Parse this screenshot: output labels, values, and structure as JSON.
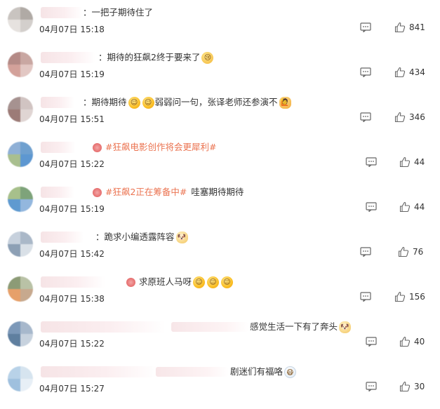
{
  "comments": [
    {
      "prefix": "：",
      "hashtag": "",
      "text": "一把子期待住了",
      "emoji": [],
      "timestamp": "04月07日 15:18",
      "likes": "841",
      "avatar_colors": [
        "#c9c4c0",
        "#b0aaa5",
        "#e6e2df",
        "#d3cfcc"
      ]
    },
    {
      "prefix": "：",
      "hashtag": "",
      "text": "期待的狂飙2终于要来了",
      "emoji": [
        "cry"
      ],
      "timestamp": "04月07日 15:19",
      "likes": "434",
      "avatar_colors": [
        "#b48a86",
        "#c9a7a2",
        "#d3a19a",
        "#e2c7c3"
      ]
    },
    {
      "prefix": "：",
      "hashtag": "",
      "text": "期待期待",
      "text2": "弱弱问一句，张译老师还参演不",
      "emoji": [
        "smile",
        "smile"
      ],
      "emoji_end": "wave",
      "timestamp": "04月07日 15:51",
      "likes": "346",
      "avatar_colors": [
        "#a69290",
        "#d1c4c2",
        "#9c7b77",
        "#e0d5d3"
      ]
    },
    {
      "prefix": "",
      "hashtag": "#狂飙电影创作将会更犀利#",
      "text": "",
      "emoji": [
        "heart"
      ],
      "timestamp": "04月07日 15:22",
      "likes": "44",
      "avatar_colors": [
        "#8fb0d6",
        "#6fa0cf",
        "#a9bf8f",
        "#5d97d1"
      ]
    },
    {
      "prefix": "",
      "hashtag": "#狂飙2正在筹备中#",
      "text": "哇塞期待期待",
      "emoji": [
        "heart"
      ],
      "timestamp": "04月07日 15:19",
      "likes": "44",
      "avatar_colors": [
        "#a7c08b",
        "#7ea37a",
        "#5f9ad0",
        "#93b7de"
      ]
    },
    {
      "prefix": "：",
      "hashtag": "",
      "text": "跪求小编透露阵容",
      "emoji": [
        "dog"
      ],
      "timestamp": "04月07日 15:42",
      "likes": "76",
      "avatar_colors": [
        "#c7d1dd",
        "#aab8c8",
        "#8da0b5",
        "#d9e0e7"
      ]
    },
    {
      "prefix": "",
      "hashtag": "",
      "text": "求原班人马呀",
      "emoji": [
        "heart"
      ],
      "emoji_end3": "smile",
      "timestamp": "04月07日 15:38",
      "likes": "156",
      "avatar_colors": [
        "#8c9b76",
        "#b9c2a6",
        "#e6a06a",
        "#c7a98e"
      ]
    },
    {
      "prefix": "",
      "hashtag": "",
      "text": "感觉生活一下有了奔头",
      "emoji": [],
      "emoji_end": "dog",
      "timestamp": "04月07日 15:22",
      "likes": "40",
      "avatar_colors": [
        "#7c98b8",
        "#a7b8cc",
        "#5f7f9f",
        "#c7d2de"
      ]
    },
    {
      "prefix": "",
      "hashtag": "",
      "text": "剧迷们有福咯",
      "emoji": [],
      "emoji_end": "sick",
      "timestamp": "04月07日 15:27",
      "likes": "30",
      "avatar_colors": [
        "#b8d2e8",
        "#d6e4ef",
        "#9fc0de",
        "#e7eff6"
      ]
    }
  ]
}
